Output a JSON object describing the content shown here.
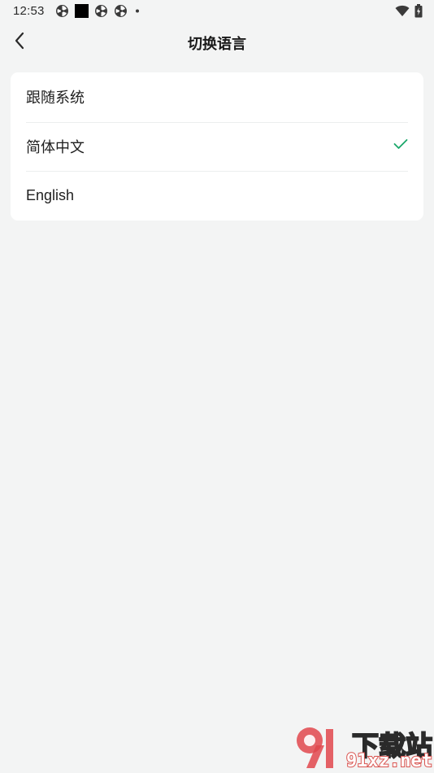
{
  "status_bar": {
    "time": "12:53",
    "left_icons": [
      "fan-icon",
      "black-square-icon",
      "fan-icon",
      "fan-icon",
      "dot-icon"
    ],
    "right_icons": [
      "wifi-icon",
      "battery-icon"
    ]
  },
  "nav": {
    "back_icon": "chevron-left-icon",
    "title": "切换语言"
  },
  "options": [
    {
      "label": "跟随系统",
      "selected": false
    },
    {
      "label": "简体中文",
      "selected": true
    },
    {
      "label": "English",
      "selected": false
    }
  ],
  "colors": {
    "background": "#f3f4f4",
    "card": "#ffffff",
    "accent": "#1aa76a",
    "divider": "#eceeee"
  },
  "watermark": {
    "logo_text": "91",
    "text_cn": "下载站",
    "text_url": "91xz.net"
  }
}
